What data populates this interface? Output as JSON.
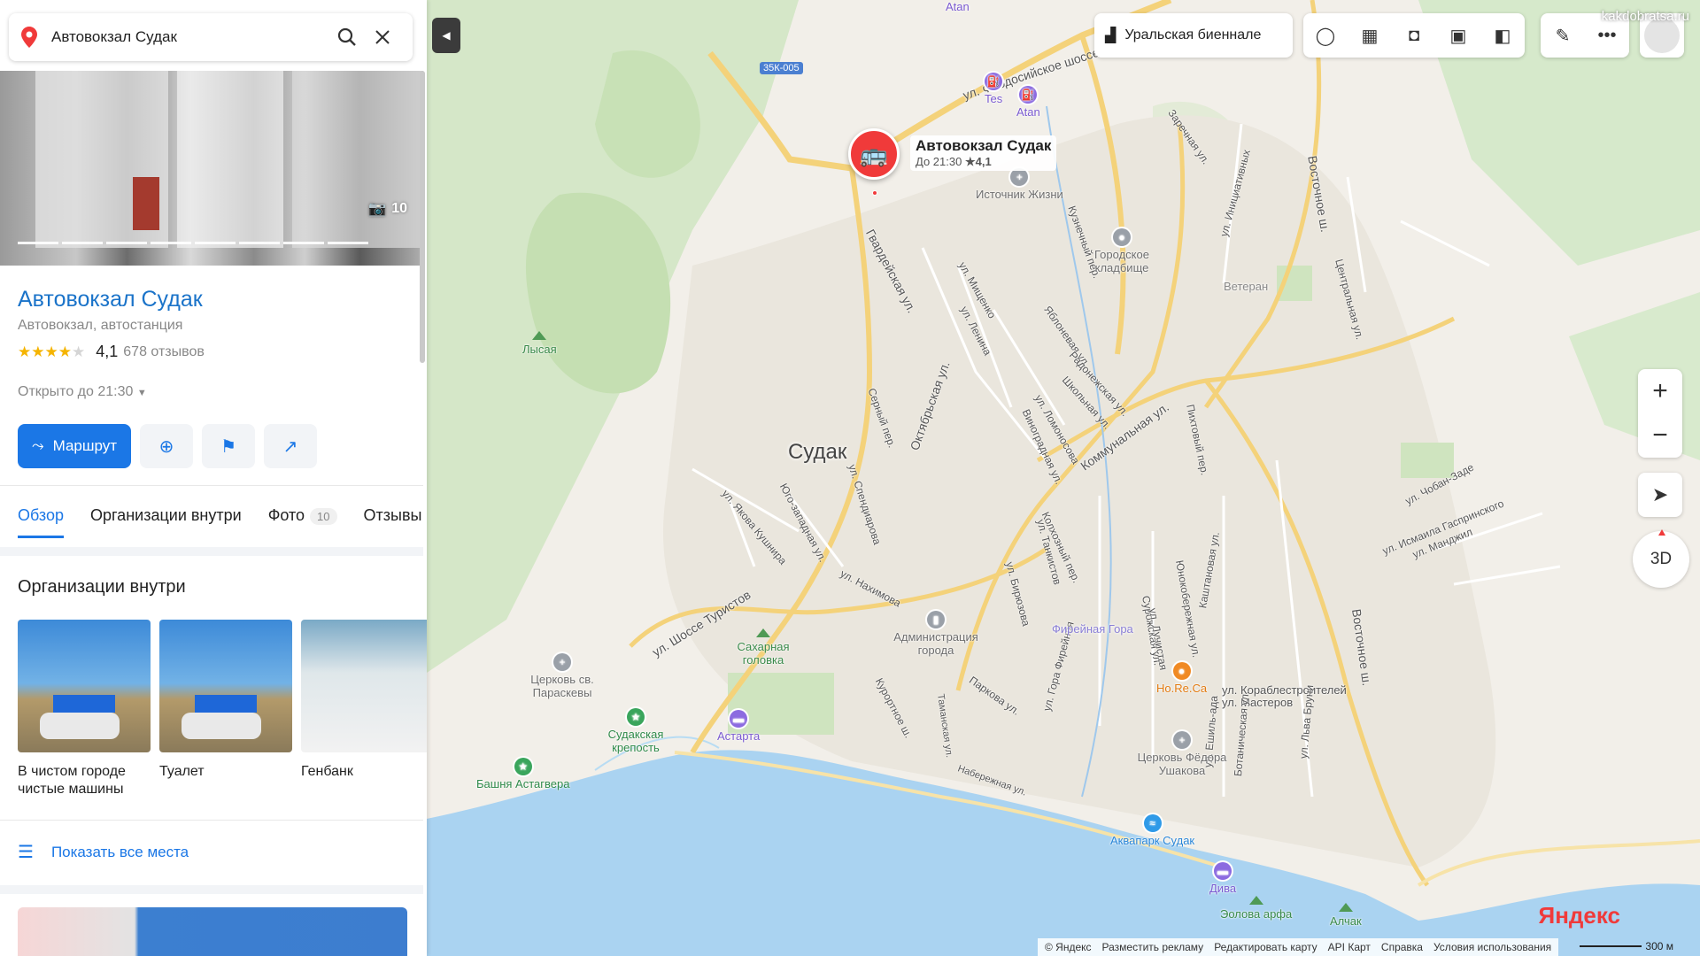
{
  "search": {
    "query": "Автовокзал Судак"
  },
  "place": {
    "title": "Автовокзал Судак",
    "category": "Автовокзал, автостанция",
    "rating_value": "4,1",
    "rating_stars": 4,
    "reviews": "678 отзывов",
    "hours": "Открыто до 21:30",
    "photo_count": "10",
    "route_label": "Маршрут"
  },
  "tabs": [
    {
      "label": "Обзор",
      "active": true
    },
    {
      "label": "Организации внутри"
    },
    {
      "label": "Фото",
      "badge": "10"
    },
    {
      "label": "Отзывы"
    }
  ],
  "orgs_section": {
    "title": "Организации внутри",
    "items": [
      {
        "name": "В чистом городе чистые машины"
      },
      {
        "name": "Туалет"
      },
      {
        "name": "Генбанк"
      }
    ],
    "show_all": "Показать все места"
  },
  "map": {
    "toolbar": {
      "biennale": "Уральская биеннале"
    },
    "watermark": "kakdobratsa.ru",
    "marker": {
      "name": "Автовокзал Судак",
      "sub": "До 21:30",
      "rating": "★4,1"
    },
    "city": "Судак",
    "road_badge": "35К-005",
    "btn3d": "3D",
    "logo": "Яндекс",
    "scale": "300 м",
    "footer": [
      "© Яндекс",
      "Разместить рекламу",
      "Редактировать карту",
      "API Карт",
      "Справка",
      "Условия использования"
    ],
    "pois": [
      {
        "name": "Tes"
      },
      {
        "name": "Atan"
      },
      {
        "name": "Atan"
      },
      {
        "name": "Источник Жизни"
      },
      {
        "name": "Городское кладбище"
      },
      {
        "name": "Ветеран"
      },
      {
        "name": "Лысая"
      },
      {
        "name": "Администрация города"
      },
      {
        "name": "Сахарная головка"
      },
      {
        "name": "Церковь св. Параскевы"
      },
      {
        "name": "Судакская крепость"
      },
      {
        "name": "Астарта"
      },
      {
        "name": "Башня Астагвера"
      },
      {
        "name": "Фирейная Гора"
      },
      {
        "name": "Ho.Re.Ca"
      },
      {
        "name": "Церковь Фёдора Ушакова"
      },
      {
        "name": "Аквапарк Судак"
      },
      {
        "name": "Дива"
      },
      {
        "name": "Эолова арфа"
      },
      {
        "name": "Алчак"
      }
    ],
    "streets": [
      "ул. Феодосийское шоссе",
      "Заречная ул.",
      "Восточное ш.",
      "Кузнечный пер.",
      "Гвардейская ул.",
      "ул. Мищенко",
      "ул. Ленина",
      "Яблоневая ул.",
      "Радонежская ул.",
      "Школьная ул.",
      "ул. Инициативных",
      "Центральная ул.",
      "Серный пер.",
      "Октябрьская ул.",
      "ул. Ломоносова",
      "Виноградная ул.",
      "Коммунальная ул.",
      "Пихтовый пер.",
      "ул. Яковa Кушнира",
      "Юго-западная ул.",
      "ул. Спендиарова",
      "ул. Нахимова",
      "ул. Шоссе Туристов",
      "ул. Бирюзова",
      "ул. Танкистов",
      "Колхозный пер.",
      "Курортное ш.",
      "Паркова ул.",
      "Таманская ул.",
      "ул. Гора Фирейная",
      "Набережная ул.",
      "Юнокобережная ул.",
      "Сурожская ул.",
      "ул. Лучистая",
      "Каштановая ул.",
      "ул. Чобан-Заде",
      "ул. Исмаила Гаспринского",
      "ул. Манджил",
      "ул. Кораблестроителей",
      "ул. Мастеров",
      "ул. Ешиль-ада",
      "Ботаническая ул.",
      "ул. Льва Бруни",
      "Восточное ш."
    ]
  }
}
